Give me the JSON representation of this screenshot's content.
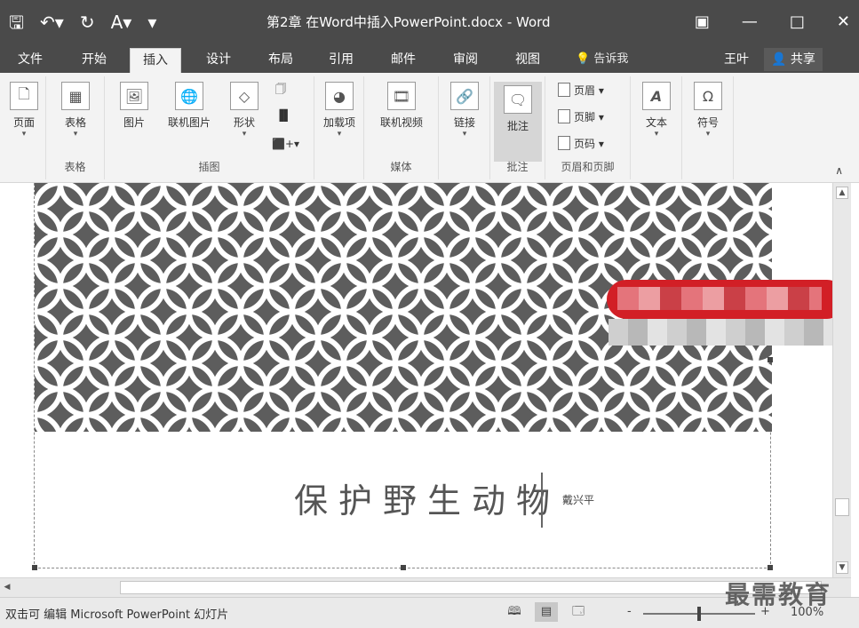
{
  "titlebar": {
    "qat": {
      "save_icon": "save-icon",
      "undo_icon": "undo-icon",
      "redo_icon": "redo-icon",
      "font_icon": "font-size-icon",
      "customize_icon": "customize-qat-icon"
    },
    "title": "第2章 在Word中插入PowerPoint.docx - Word",
    "buttons": {
      "ribbon_display_icon": "ribbon-display-icon",
      "minimize_icon": "minimize-icon",
      "maximize_icon": "maximize-icon",
      "close_icon": "close-icon"
    }
  },
  "tabs": {
    "items": [
      "文件",
      "开始",
      "插入",
      "设计",
      "布局",
      "引用",
      "邮件",
      "审阅",
      "视图"
    ],
    "active_index": 2,
    "tell_me": "告诉我",
    "user": "王叶",
    "share": "共享"
  },
  "ribbon": {
    "groups": [
      {
        "label": "",
        "buttons": [
          "页面"
        ]
      },
      {
        "label": "表格",
        "buttons": [
          "表格"
        ]
      },
      {
        "label": "插图",
        "buttons": [
          "图片",
          "联机图片",
          "形状"
        ]
      },
      {
        "label": "",
        "buttons": [
          "加载项"
        ]
      },
      {
        "label": "媒体",
        "buttons": [
          "联机视频"
        ]
      },
      {
        "label": "",
        "buttons": [
          "链接"
        ]
      },
      {
        "label": "批注",
        "buttons": [
          "批注"
        ]
      },
      {
        "label": "页眉和页脚",
        "buttons": [
          "页眉",
          "页脚",
          "页码"
        ]
      },
      {
        "label": "",
        "buttons": [
          "文本"
        ]
      },
      {
        "label": "",
        "buttons": [
          "符号"
        ]
      }
    ]
  },
  "document": {
    "slide_title": "保护野生动物",
    "slide_subtitle": "戴兴平"
  },
  "statusbar": {
    "text": "双击可 编辑 Microsoft PowerPoint 幻灯片",
    "zoom_minus": "-",
    "zoom_plus": "+",
    "zoom_percent": "100%",
    "zoom_level": 1.0
  },
  "watermark": "最需教育"
}
